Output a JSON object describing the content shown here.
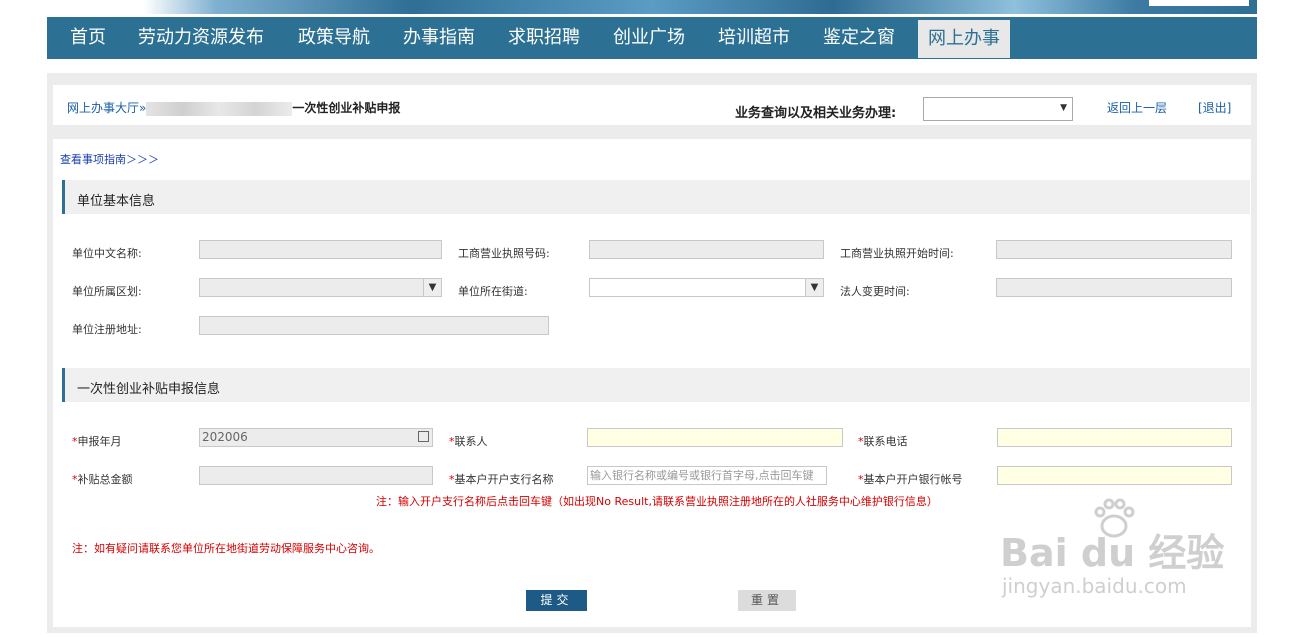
{
  "nav": {
    "items": [
      "首页",
      "劳动力资源发布",
      "政策导航",
      "办事指南",
      "求职招聘",
      "创业广场",
      "培训超市",
      "鉴定之窗",
      "网上办事"
    ],
    "active_index": 8
  },
  "breadcrumb": {
    "root": "网上办事大厅",
    "sep": "»",
    "current": "一次性创业补贴申报"
  },
  "topbar": {
    "query_label": "业务查询以及相关业务办理:",
    "query_value": "",
    "back_label": "返回上一层",
    "logout_label": "[退出]"
  },
  "guide_link": "查看事项指南＞＞＞",
  "section1": {
    "title": "单位基本信息",
    "fields": {
      "name_cn": "单位中文名称:",
      "license_no": "工商营业执照号码:",
      "license_start": "工商营业执照开始时间:",
      "district": "单位所属区划:",
      "street": "单位所在街道:",
      "legal_change": "法人变更时间:",
      "reg_address": "单位注册地址:"
    }
  },
  "section2": {
    "title": "一次性创业补贴申报信息",
    "fields": {
      "report_month": "申报年月",
      "report_month_value": "202006",
      "contact": "联系人",
      "phone": "联系电话",
      "total_amount": "补贴总金额",
      "bank_branch": "基本户开户支行名称",
      "bank_branch_placeholder": "输入银行名称或编号或银行首字母,点击回车键",
      "bank_account": "基本户开户银行帐号"
    },
    "bank_note": "注：输入开户支行名称后点击回车键（如出现No Result,请联系营业执照注册地所在的人社服务中心维护银行信息）"
  },
  "footer_note": "注：如有疑问请联系您单位所在地街道劳动保障服务中心咨询。",
  "buttons": {
    "submit": "提交",
    "reset": "重置"
  },
  "watermark": {
    "brand": "Bai du 经验",
    "url": "jingyan.baidu.com"
  },
  "colors": {
    "nav_bg": "#2c7193",
    "link": "#1a5fa8",
    "required": "#d00000",
    "submit_bg": "#1e5a86"
  }
}
